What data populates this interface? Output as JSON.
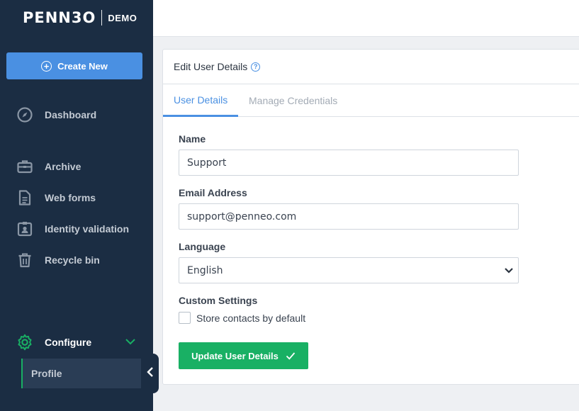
{
  "brand": {
    "logo": "PENN3O",
    "env_badge": "DEMO"
  },
  "sidebar": {
    "create_new": "Create New",
    "items": [
      {
        "label": "Dashboard",
        "icon": "compass-icon"
      },
      {
        "label": "Archive",
        "icon": "briefcase-icon"
      },
      {
        "label": "Web forms",
        "icon": "document-icon"
      },
      {
        "label": "Identity validation",
        "icon": "id-badge-icon"
      },
      {
        "label": "Recycle bin",
        "icon": "trash-icon"
      }
    ],
    "configure": {
      "label": "Configure",
      "icon": "gear-icon"
    },
    "configure_children": [
      {
        "label": "Profile"
      }
    ]
  },
  "card": {
    "title": "Edit User Details",
    "tabs": [
      {
        "label": "User Details",
        "active": true
      },
      {
        "label": "Manage Credentials",
        "active": false
      }
    ],
    "form": {
      "name_label": "Name",
      "name_value": "Support",
      "email_label": "Email Address",
      "email_value": "support@penneo.com",
      "language_label": "Language",
      "language_value": "English",
      "custom_label": "Custom Settings",
      "store_contacts_label": "Store contacts by default",
      "store_contacts_checked": false,
      "submit_label": "Update User Details"
    }
  },
  "colors": {
    "sidebar_bg": "#1b2d43",
    "primary": "#4a90e2",
    "success": "#19b064"
  }
}
